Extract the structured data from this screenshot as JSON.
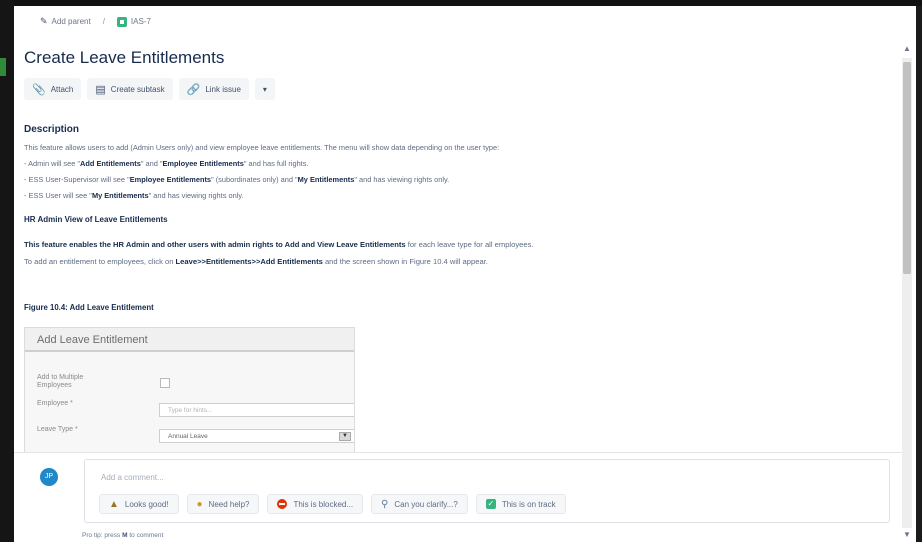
{
  "breadcrumb": {
    "add_parent": "Add parent",
    "separator": "/",
    "issue_key": "IAS-7"
  },
  "title": "Create Leave Entitlements",
  "toolbar": {
    "attach": "Attach",
    "create_subtask": "Create subtask",
    "link_issue": "Link issue",
    "more": "▾"
  },
  "description": {
    "heading": "Description",
    "intro": "This feature allows users to add (Admin Users only) and view employee leave entitlements. The menu will show data depending on the user type:",
    "admin_pre": "- Admin will see \"",
    "admin_b1": "Add Entitlements",
    "admin_mid": "\" and \"",
    "admin_b2": "Employee Entitlements",
    "admin_post": "\" and has full rights.",
    "sup_pre": "- ESS User-Supervisor will see \"",
    "sup_b1": "Employee Entitlements",
    "sup_mid": "\" (subordinates only) and \"",
    "sup_b2": "My Entitlements",
    "sup_post": "\" and has viewing rights only.",
    "ess_pre": "- ESS User will see \"",
    "ess_b1": "My Entitlements",
    "ess_post": "\" and has viewing rights only.",
    "hr_heading": "HR Admin View of Leave Entitlements",
    "feature_bold": "This feature enables the HR Admin and other users with admin rights to Add and View Leave Entitlements",
    "feature_rest": " for each leave type for all employees.",
    "nav_pre": "To add an entitlement to employees, click on ",
    "nav_b1": "Leave>>Entitlements>>Add Entitlements",
    "nav_post": " and the screen shown in Figure 10.4 will appear.",
    "figure_title": "Figure 10.4: Add Leave Entitlement"
  },
  "figure_form": {
    "header": "Add Leave Entitlement",
    "multi_label": "Add to Multiple Employees",
    "employee_label": "Employee *",
    "employee_placeholder": "Type for hints...",
    "leave_type_label": "Leave Type *",
    "leave_type_value": "Annual Leave",
    "dropdown_glyph": "▼"
  },
  "comment": {
    "avatar_initials": "JP",
    "placeholder": "Add a comment...",
    "chips": [
      "Looks good!",
      "Need help?",
      "This is blocked...",
      "Can you clarify...?",
      "This is on track"
    ],
    "protip_pre": "Pro tip: press ",
    "protip_key": "M",
    "protip_post": " to comment"
  },
  "scroll": {
    "up": "▲",
    "down": "▼"
  },
  "icons": {
    "pencil": "pencil-icon",
    "story": "story-icon",
    "attach": "paperclip-icon",
    "subtask": "subtask-icon",
    "link": "link-icon"
  }
}
